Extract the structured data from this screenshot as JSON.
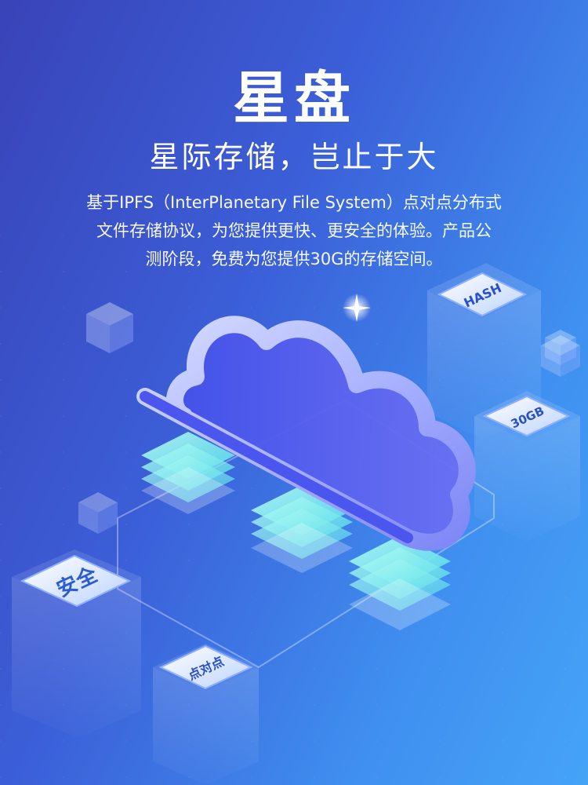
{
  "header": {
    "title": "星盘",
    "subtitle": "星际存储，岂止于大"
  },
  "description": {
    "line1": "基于IPFS（InterPlanetary File System）点对点分布式",
    "line2": "文件存储协议，为您提供更快、更安全的体验。产品公",
    "line3": "测阶段，免费为您提供30G的存储空间。"
  },
  "illustration": {
    "tags": {
      "hash": "HASH",
      "capacity": "30GB",
      "security": "安全",
      "p2p": "点对点"
    }
  },
  "colors": {
    "bg_start": "#3a43b8",
    "bg_end": "#45a4f6",
    "cloud": "#5a6ff0",
    "server_glow": "#7ff0e8"
  }
}
